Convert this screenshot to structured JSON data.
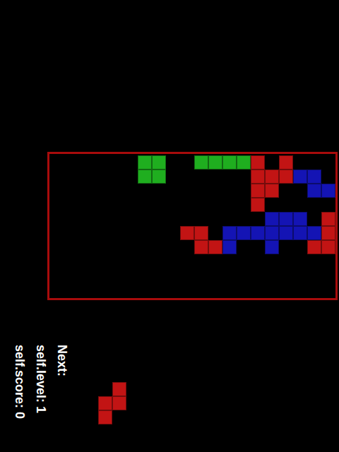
{
  "board": {
    "legend": {
      "G": "#1fae1f",
      "R": "#c21414",
      "B": "#1414b4"
    },
    "rows": [
      "......GG..GGGGR.R...",
      "......GG......RRRBB.",
      "..............RR..BB",
      "..............R.....",
      "...............BBB.R",
      ".........RR.BBBBBBBR",
      "..........RRB..B..RR",
      "....................",
      "....................",
      "...................."
    ]
  },
  "stats": [
    {
      "text": "self.score: 0"
    },
    {
      "text": "self.level: 1"
    }
  ],
  "next": {
    "label": "Next:",
    "rows": [
      ".R",
      "RR",
      "R."
    ]
  }
}
